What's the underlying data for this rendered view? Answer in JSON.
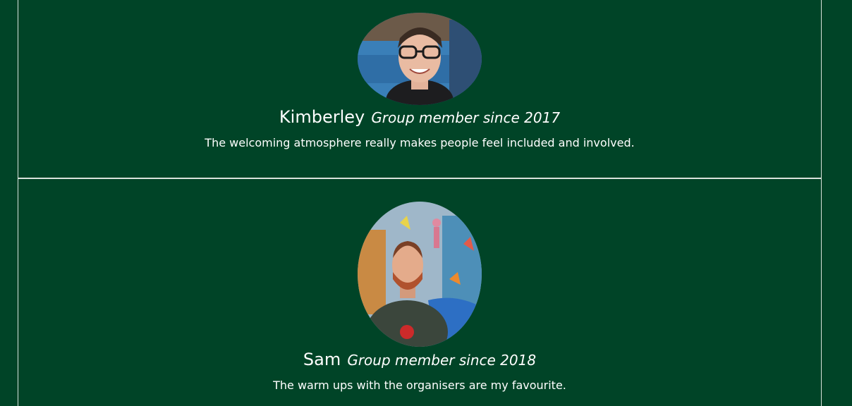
{
  "testimonials": [
    {
      "name": "Kimberley",
      "member_since": "Group member since 2017",
      "quote": "The welcoming atmosphere really makes people feel included and involved."
    },
    {
      "name": "Sam",
      "member_since": "Group member since 2018",
      "quote": "The warm ups with the organisers are my favourite."
    }
  ],
  "colors": {
    "background": "#004427",
    "divider": "#d9e3dc",
    "text": "#ffffff"
  }
}
